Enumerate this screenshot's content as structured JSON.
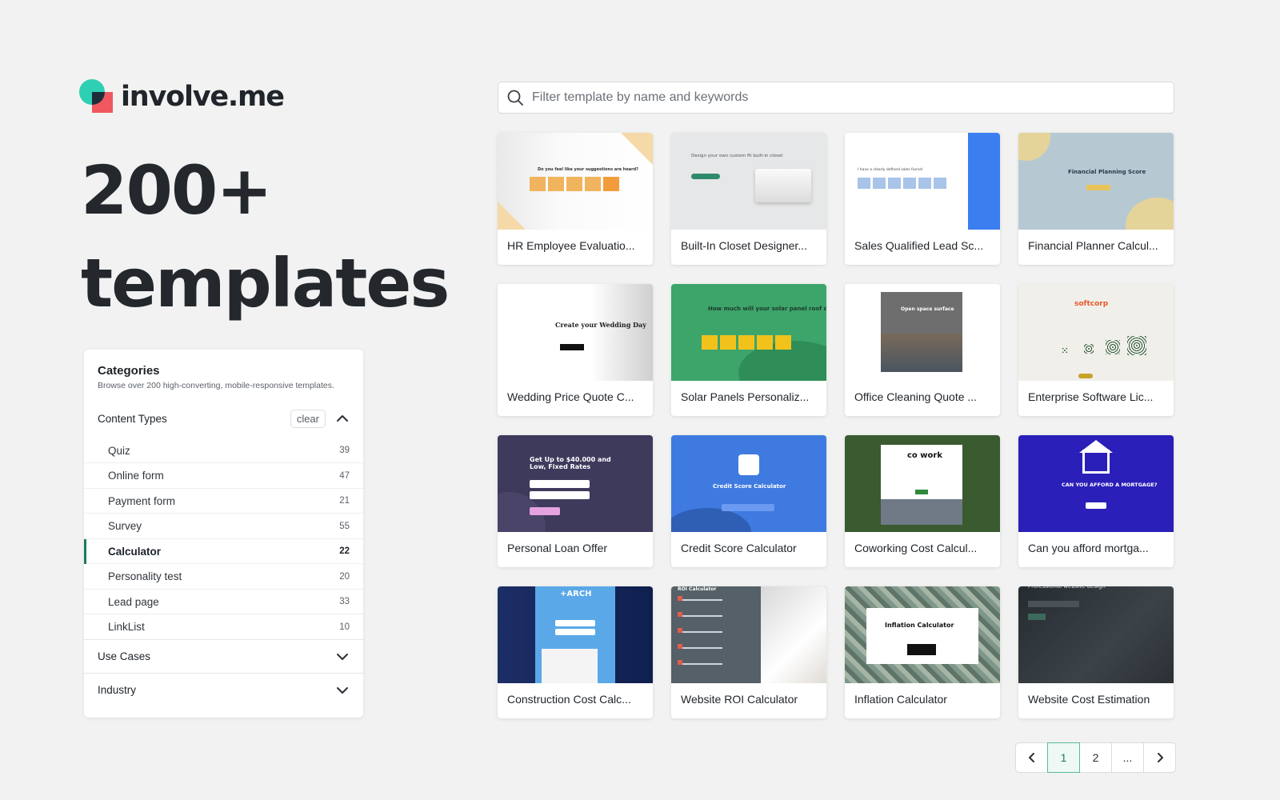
{
  "brand": {
    "name": "involve.me"
  },
  "hero": {
    "line1": "200+",
    "line2": "templates"
  },
  "categories": {
    "title": "Categories",
    "subtitle": "Browse over 200 high-converting, mobile-responsive templates.",
    "content_types": {
      "label": "Content Types",
      "clear_label": "clear",
      "items": [
        {
          "name": "Quiz",
          "count": "39"
        },
        {
          "name": "Online form",
          "count": "47"
        },
        {
          "name": "Payment form",
          "count": "21"
        },
        {
          "name": "Survey",
          "count": "55"
        },
        {
          "name": "Calculator",
          "count": "22",
          "active": true
        },
        {
          "name": "Personality test",
          "count": "20"
        },
        {
          "name": "Lead page",
          "count": "33"
        },
        {
          "name": "LinkList",
          "count": "10"
        }
      ]
    },
    "use_cases": {
      "label": "Use Cases"
    },
    "industry": {
      "label": "Industry"
    }
  },
  "search": {
    "placeholder": "Filter template by name and keywords",
    "value": ""
  },
  "templates": [
    {
      "title": "HR Employee Evaluatio...",
      "thumb_text": "Do you feel like your suggestions are heard?"
    },
    {
      "title": "Built-In Closet Designer...",
      "thumb_text": "Design your own custom fit built-in closet"
    },
    {
      "title": "Sales Qualified Lead Sc...",
      "thumb_text": "I have a clearly defined sales funnel"
    },
    {
      "title": "Financial Planner Calcul...",
      "thumb_text": "Financial Planning Score"
    },
    {
      "title": "Wedding Price Quote C...",
      "thumb_text": "Create your Wedding Day"
    },
    {
      "title": "Solar Panels Personaliz...",
      "thumb_text": "How much will your solar panel roof cost?"
    },
    {
      "title": "Office Cleaning Quote ...",
      "thumb_text": "Open space surface"
    },
    {
      "title": "Enterprise Software Lic...",
      "thumb_text": "softcorp"
    },
    {
      "title": "Personal Loan Offer",
      "thumb_text": "Get Up to $40.000 and Low, Fixed Rates"
    },
    {
      "title": "Credit Score Calculator",
      "thumb_text": "Credit Score Calculator"
    },
    {
      "title": "Coworking Cost Calcul...",
      "thumb_text": "co work"
    },
    {
      "title": "Can you afford mortga...",
      "thumb_text": "CAN YOU AFFORD A MORTGAGE?"
    },
    {
      "title": "Construction Cost Calc...",
      "thumb_text": "+ARCH"
    },
    {
      "title": "Website ROI Calculator",
      "thumb_text": "ROI Calculator"
    },
    {
      "title": "Inflation Calculator",
      "thumb_text": "Inflation Calculator"
    },
    {
      "title": "Website Cost Estimation",
      "thumb_text": "Professional website design"
    }
  ],
  "pagination": {
    "pages": [
      "1",
      "2",
      "..."
    ],
    "current": "1"
  },
  "colors": {
    "accent": "#1d7a64",
    "logo_teal": "#2ecfb3",
    "logo_red": "#f0575e",
    "background": "#f1f2f1"
  }
}
